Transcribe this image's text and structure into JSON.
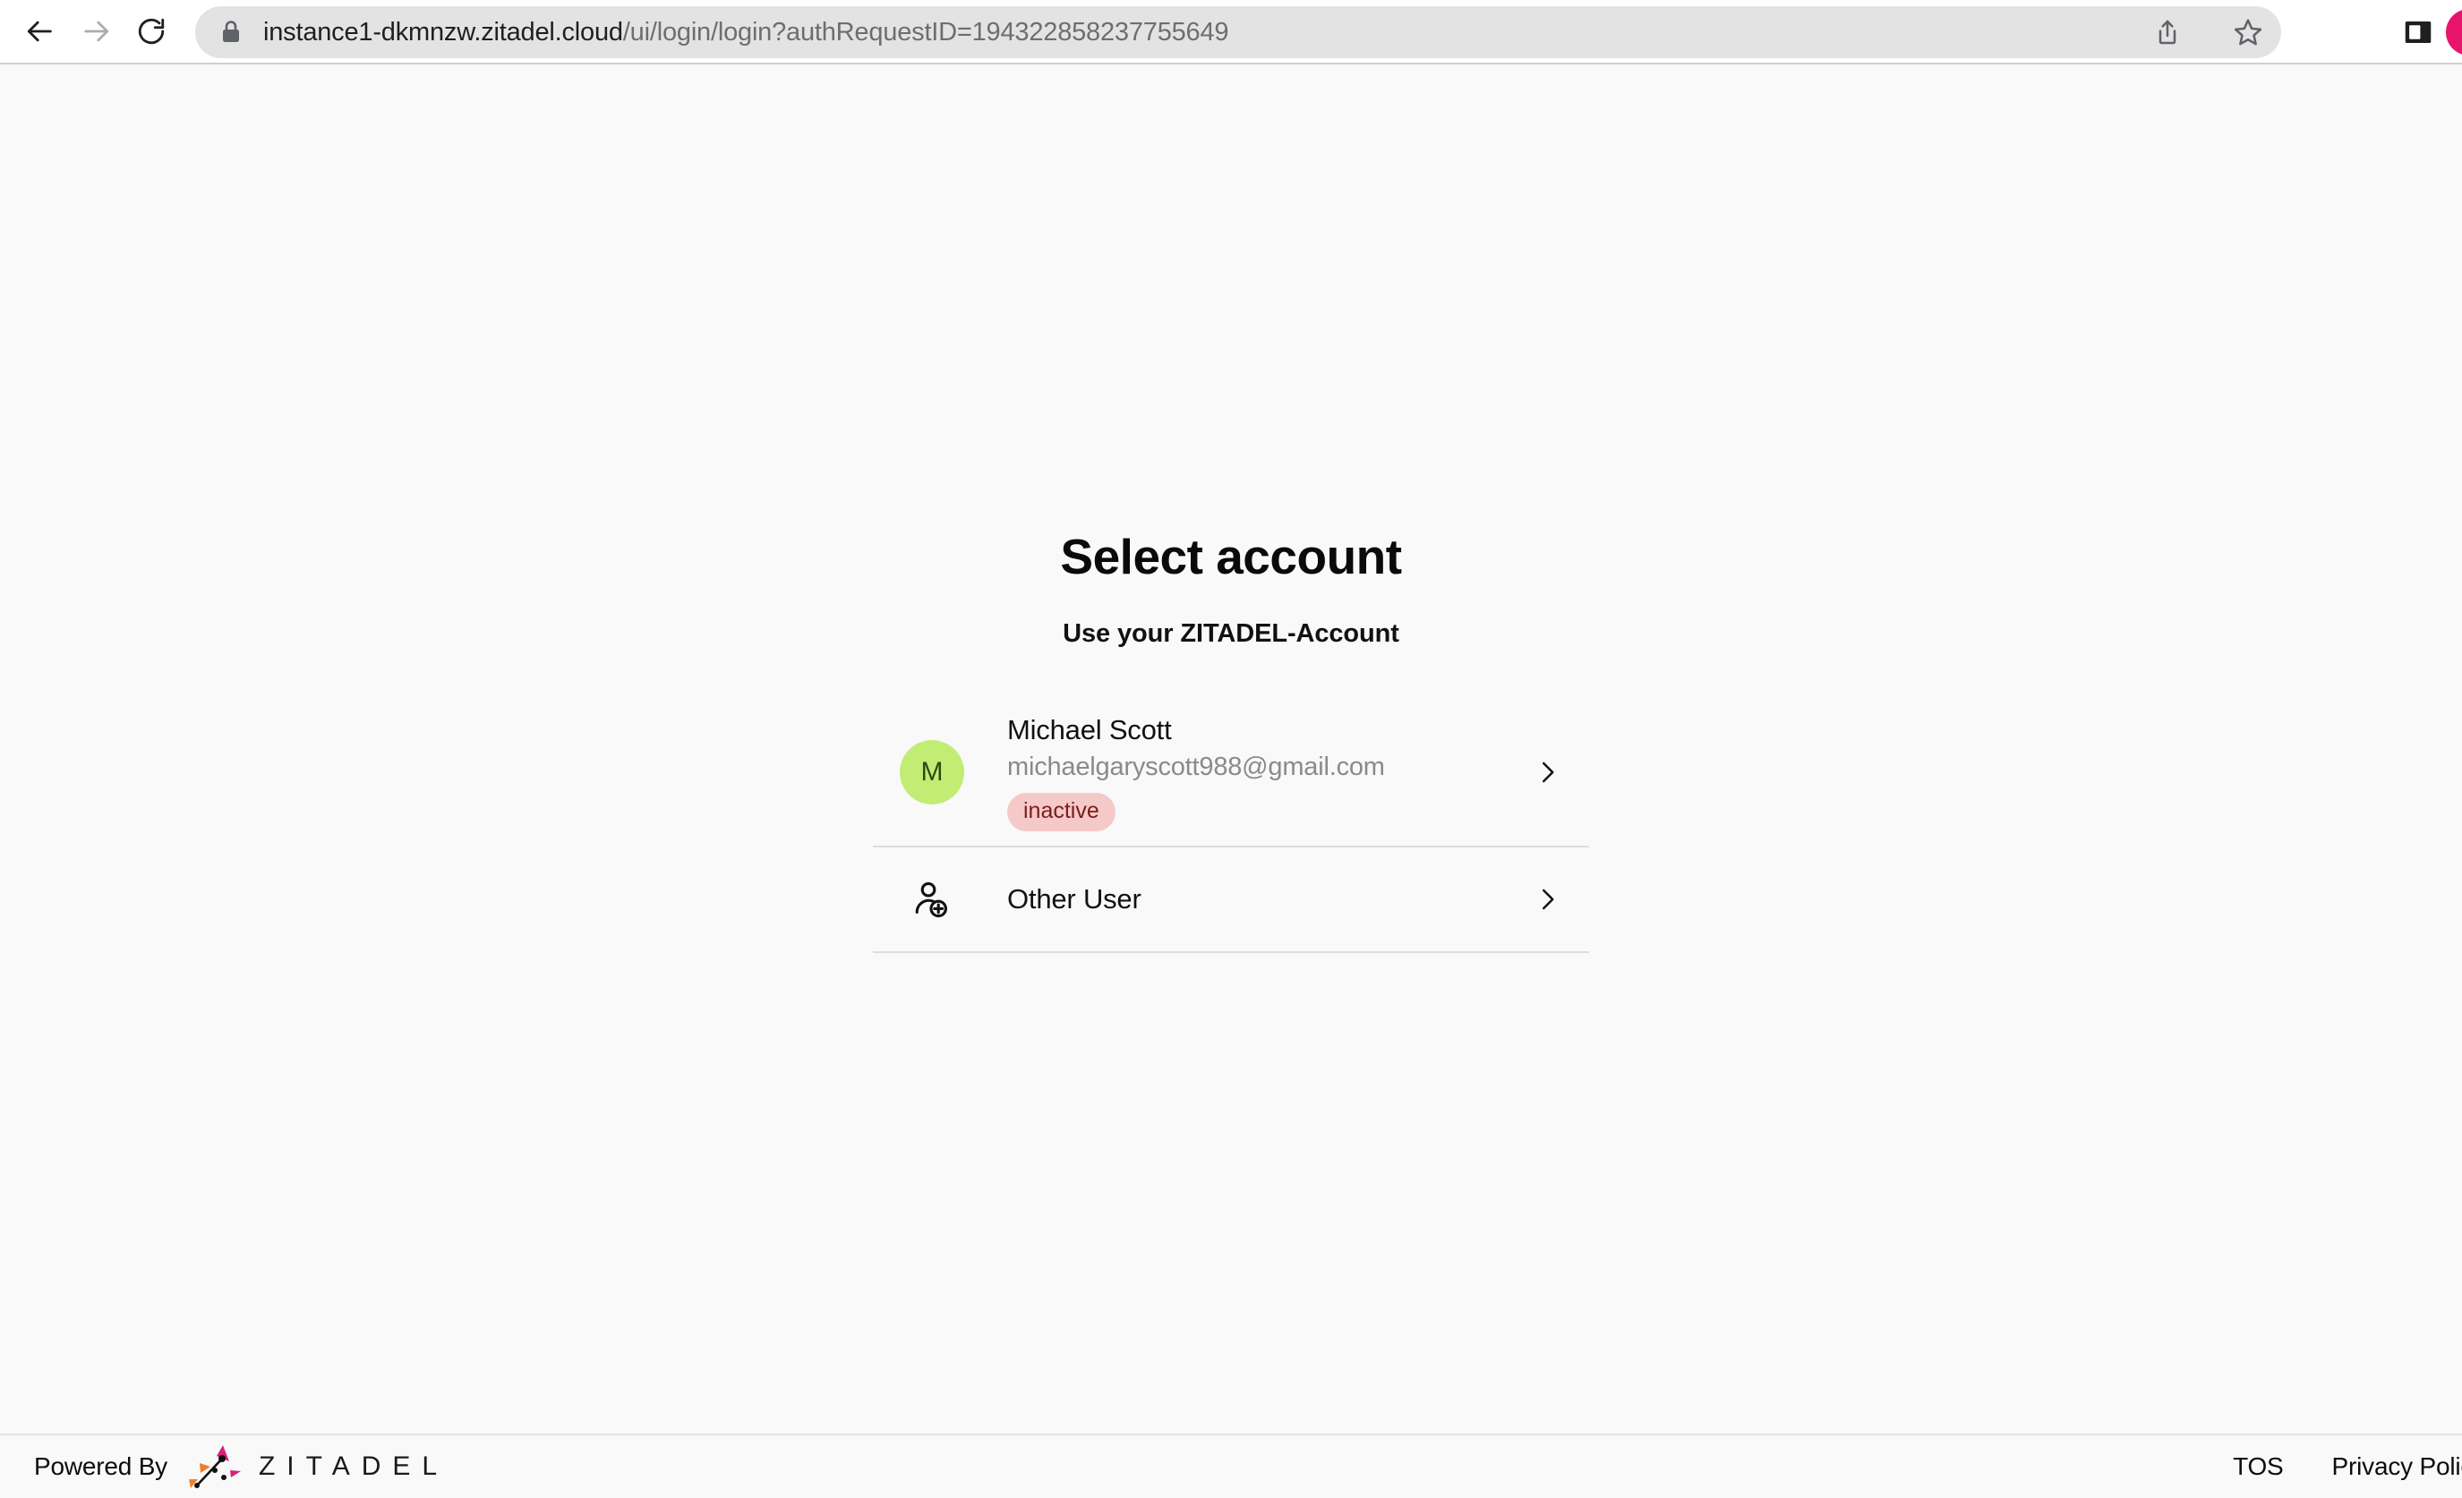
{
  "browser": {
    "back_label": "Back",
    "forward_label": "Forward",
    "reload_label": "Reload",
    "url_domain": "instance1-dkmnzw.zitadel.cloud",
    "url_path": "/ui/login/login?authRequestID=194322858237755649",
    "lock_icon": "lock-icon",
    "share_icon": "share-icon",
    "bookmark_icon": "star-icon",
    "sidebar_icon": "sidebar-panel-icon",
    "profile_color": "#e8136a"
  },
  "page": {
    "title": "Select account",
    "subtitle": "Use your ZITADEL-Account",
    "background": "#f9f9f9"
  },
  "accounts": [
    {
      "initial": "M",
      "name": "Michael Scott",
      "email": "michaelgaryscott988@gmail.com",
      "status": "inactive",
      "avatar_color": "#c2ed74",
      "avatar_text_color": "#2d4a10",
      "badge_bg": "#f6c9c9",
      "badge_color": "#7a1c1c",
      "chevron_icon": "chevron-right-icon"
    }
  ],
  "other_user": {
    "label": "Other User",
    "icon": "add-user-icon",
    "chevron_icon": "chevron-right-icon"
  },
  "footer": {
    "powered_by": "Powered By",
    "brand": "ZITADEL",
    "links": [
      {
        "label": "TOS"
      },
      {
        "label": "Privacy Policy"
      }
    ]
  }
}
